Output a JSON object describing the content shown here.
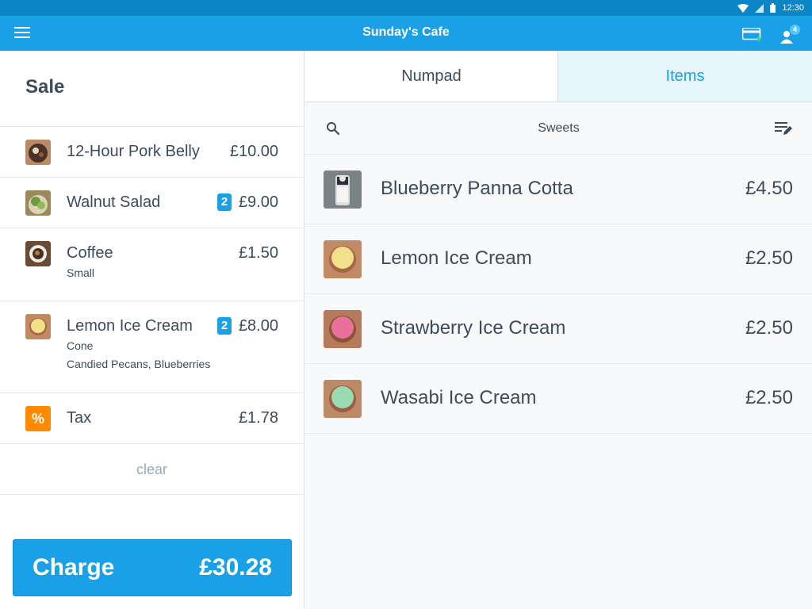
{
  "status_bar": {
    "time": "12:30"
  },
  "app_bar": {
    "title": "Sunday's Cafe",
    "menu_icon": "hamburger-menu-icon",
    "card_icon": "credit-card-icon",
    "user_icon": "user-icon",
    "user_badge": "4"
  },
  "sale": {
    "title": "Sale",
    "lines": [
      {
        "name": "12-Hour Pork Belly",
        "price": "£10.00",
        "qty": "",
        "modifiers": []
      },
      {
        "name": "Walnut Salad",
        "price": "£9.00",
        "qty": "2",
        "modifiers": []
      },
      {
        "name": "Coffee",
        "price": "£1.50",
        "qty": "",
        "modifiers": [
          "Small"
        ]
      },
      {
        "name": "Lemon Ice Cream",
        "price": "£8.00",
        "qty": "2",
        "modifiers": [
          "Cone",
          "Candied Pecans, Blueberries"
        ]
      }
    ],
    "tax": {
      "icon_glyph": "%",
      "name": "Tax",
      "price": "£1.78"
    },
    "clear_label": "clear",
    "charge": {
      "label": "Charge",
      "amount": "£30.28"
    }
  },
  "tabs": {
    "numpad": "Numpad",
    "items": "Items",
    "active": "items"
  },
  "category": {
    "name": "Sweets",
    "search_icon": "search-icon",
    "edit_icon": "edit-list-icon"
  },
  "items": [
    {
      "name": "Blueberry Panna Cotta",
      "price": "£4.50"
    },
    {
      "name": "Lemon Ice Cream",
      "price": "£2.50"
    },
    {
      "name": "Strawberry Ice Cream",
      "price": "£2.50"
    },
    {
      "name": "Wasabi Ice Cream",
      "price": "£2.50"
    }
  ],
  "colors": {
    "accent": "#1aa0e6",
    "status_bar": "#0a86c6",
    "tax_orange": "#ff8a00",
    "text": "#3d4b5c",
    "muted": "#9aa8b5"
  }
}
